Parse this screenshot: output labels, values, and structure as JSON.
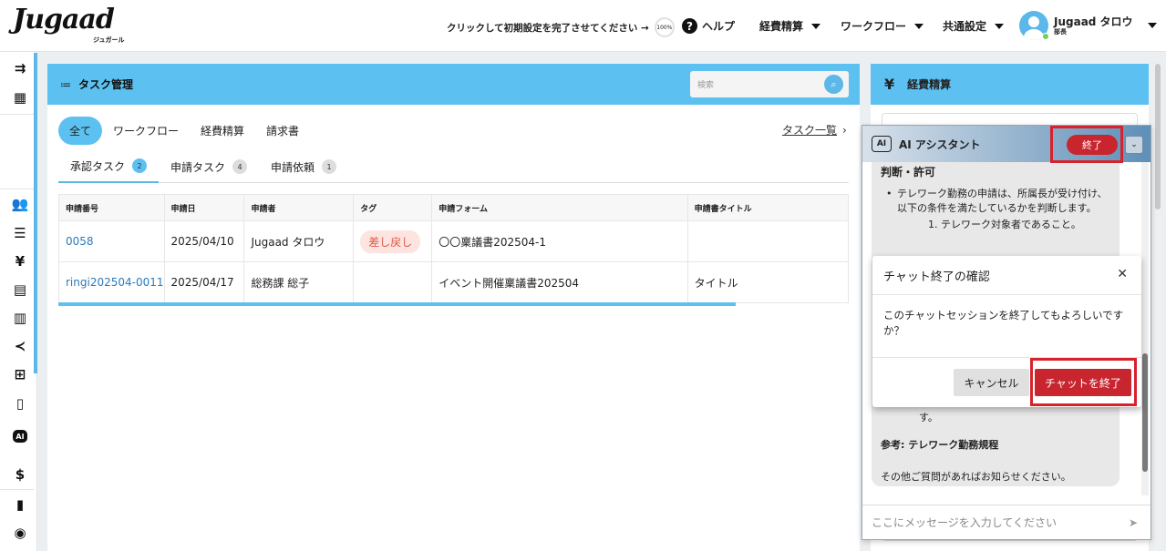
{
  "header": {
    "logo": "Jugaad",
    "logo_sub": "ジュガール",
    "setup_text": "クリックして初期設定を完了させてください →",
    "setup_progress": "100%",
    "help": "ヘルプ",
    "menus": [
      "経費精算",
      "ワークフロー",
      "共通設定"
    ],
    "user_name": "Jugaad タロウ",
    "user_role": "部長"
  },
  "task_panel": {
    "title": "タスク管理",
    "search_placeholder": "検索",
    "filters": [
      "全て",
      "ワークフロー",
      "経費精算",
      "請求書"
    ],
    "task_list_link": "タスク一覧",
    "subtabs": [
      {
        "label": "承認タスク",
        "count": "2"
      },
      {
        "label": "申請タスク",
        "count": "4"
      },
      {
        "label": "申請依頼",
        "count": "1"
      }
    ],
    "columns": [
      "申請番号",
      "申請日",
      "申請者",
      "タグ",
      "申請フォーム",
      "申請書タイトル"
    ],
    "rows": [
      {
        "number": "0058",
        "date": "2025/04/10",
        "applicant": "Jugaad タロウ",
        "tag": "差し戻し",
        "form": "〇〇稟議書202504-1",
        "title": ""
      },
      {
        "number": "ringi202504-0011",
        "date": "2025/04/17",
        "applicant": "総務課 総子",
        "tag": "",
        "form": "イベント開催稟議書202504",
        "title": "タイトル"
      }
    ]
  },
  "expense_panel": {
    "title": "経費精算"
  },
  "ai": {
    "title": "AI アシスタント",
    "end_label": "終了",
    "heading": "判断・許可",
    "bullet": "テレワーク勤務の申請は、所属長が受け付け、以下の条件を満たしているかを判断します。",
    "sub1": "1. テレワーク対象者であること。",
    "tail": "す。",
    "reference": "参考: テレワーク勤務規程",
    "closing": "その他ご質問があればお知らせください。",
    "input_placeholder": "ここにメッセージを入力してください"
  },
  "dialog": {
    "title": "チャット終了の確認",
    "message": "このチャットセッションを終了してもよろしいですか？",
    "cancel": "キャンセル",
    "confirm": "チャットを終了"
  }
}
